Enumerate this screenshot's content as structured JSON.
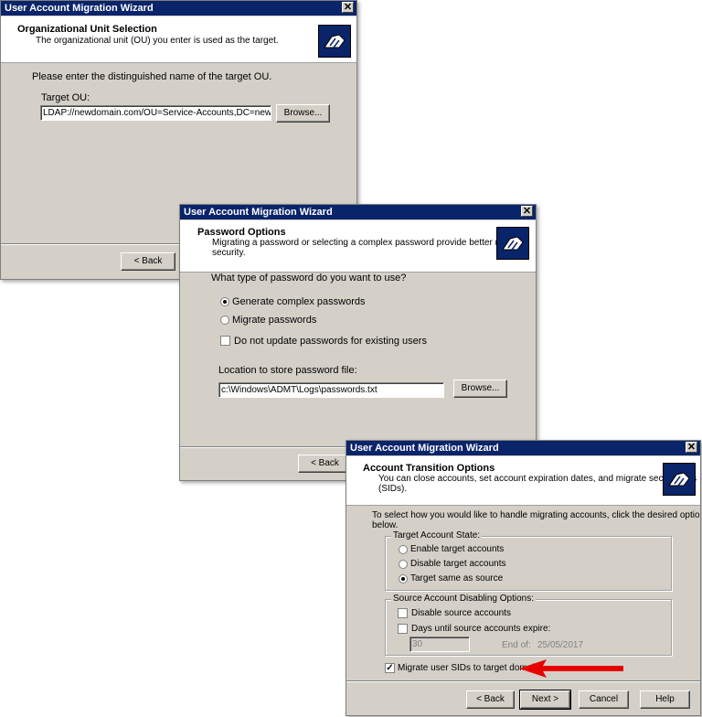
{
  "icon": "migration-wizard-icon",
  "close_glyph": "✕",
  "w1": {
    "title": "User Account Migration Wizard",
    "header_title": "Organizational Unit Selection",
    "header_desc": "The organizational unit (OU) you enter is used as the target.",
    "prompt": "Please enter the distinguished name of the target OU.",
    "field_label": "Target OU:",
    "field_value": "LDAP://newdomain.com/OU=Service-Accounts,DC=newdomain,D",
    "browse": "Browse...",
    "back": "< Back"
  },
  "w2": {
    "title": "User Account Migration Wizard",
    "header_title": "Password Options",
    "header_desc_1": "Migrating a password or selecting a complex password provide better network",
    "header_desc_2": "security.",
    "question": "What type of password do you want to use?",
    "opt_complex": "Generate complex passwords",
    "opt_migrate": "Migrate passwords",
    "opt_noupdate": "Do not update passwords for existing users",
    "loc_label": "Location to store password file:",
    "loc_value": "c:\\Windows\\ADMT\\Logs\\passwords.txt",
    "browse": "Browse...",
    "back": "< Back"
  },
  "w3": {
    "title": "User Account Migration Wizard",
    "header_title": "Account Transition Options",
    "header_desc_1": "You can close accounts, set account expiration dates, and migrate security IDs",
    "header_desc_2": "(SIDs).",
    "intro_1": "To select how you would like to handle migrating accounts, click the desired options",
    "intro_2": "below.",
    "group1_label": "Target Account State:",
    "opt_enable": "Enable target accounts",
    "opt_disable": "Disable target accounts",
    "opt_same": "Target same as source",
    "group2_label": "Source Account Disabling Options:",
    "opt_disable_src": "Disable source accounts",
    "opt_days": "Days until source accounts expire:",
    "days_value": "30",
    "end_of_label": "End of:",
    "end_of_value": "25/05/2017",
    "opt_sid": "Migrate user SIDs to target domain",
    "back": "< Back",
    "next": "Next >",
    "cancel": "Cancel",
    "help": "Help"
  },
  "annotation_color": "#e60000"
}
